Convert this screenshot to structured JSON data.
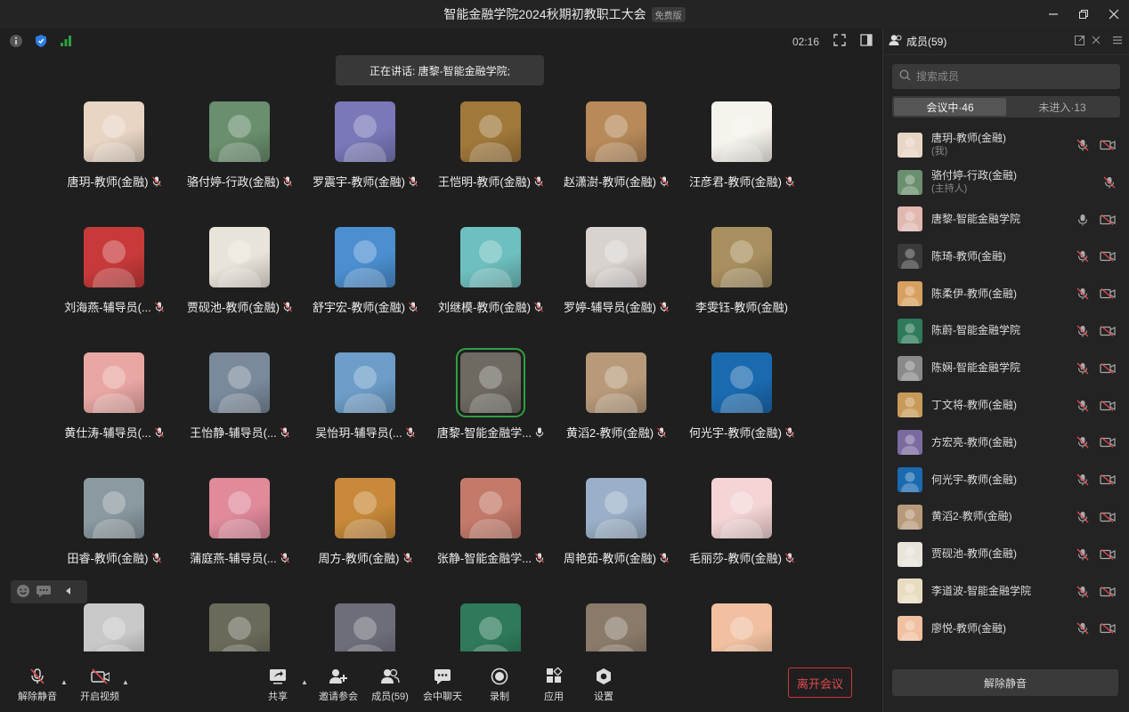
{
  "window": {
    "title": "智能金融学院2024秋期初教职工大会",
    "badge": "免费版"
  },
  "meeting": {
    "timer": "02:16",
    "speaking": "正在讲话: 唐黎-智能金融学院;"
  },
  "colors": {
    "accent_green": "#2ea043",
    "leave_red": "#d0343a",
    "muted_red": "#e04a4f"
  },
  "grid": [
    {
      "name": "唐玥-教师(金融)",
      "mic": "muted",
      "color": "#e8d5c4",
      "icon": "baby-avatar"
    },
    {
      "name": "骆付婷-行政(金融)",
      "mic": "muted",
      "color": "#6a8f6e",
      "icon": "street-avatar"
    },
    {
      "name": "罗震宇-教师(金融)",
      "mic": "muted",
      "color": "#7a78b8",
      "icon": "bear-avatar"
    },
    {
      "name": "王恺明-教师(金融)",
      "mic": "muted",
      "color": "#a0783a",
      "icon": "leopard-avatar"
    },
    {
      "name": "赵潇澍-教师(金融)",
      "mic": "muted",
      "color": "#b88a5a",
      "icon": "cartoon-avatar"
    },
    {
      "name": "汪彦君-教师(金融)",
      "mic": "muted",
      "color": "#f6f2ec",
      "icon": "lion-avatar"
    },
    {
      "name": "刘海燕-辅导员(...",
      "mic": "muted",
      "color": "#c83a3a",
      "icon": "girl-avatar"
    },
    {
      "name": "贾砚池-教师(金融)",
      "mic": "muted",
      "color": "#e9e4d9",
      "icon": "glasses-avatar"
    },
    {
      "name": "舒宇宏-教师(金融)",
      "mic": "muted",
      "color": "#4b8fd0",
      "icon": "plant-avatar"
    },
    {
      "name": "刘继模-教师(金融)",
      "mic": "muted",
      "color": "#6ec0c0",
      "icon": "sprout-avatar"
    },
    {
      "name": "罗婷-辅导员(金融)",
      "mic": "muted",
      "color": "#d9d3cf",
      "icon": "woman-avatar"
    },
    {
      "name": "李雯钰-教师(金融)",
      "mic": "none",
      "color": "#a88f5f",
      "icon": "cat-avatar"
    },
    {
      "name": "黄仕涛-辅导员(...",
      "mic": "muted",
      "color": "#e9a7a3",
      "icon": "blossom-avatar"
    },
    {
      "name": "王怡静-辅导员(...",
      "mic": "muted",
      "color": "#7a8a9b",
      "icon": "musician-avatar"
    },
    {
      "name": "吴怡玥-辅导员(...",
      "mic": "muted",
      "color": "#6d9dc8",
      "icon": "road-avatar"
    },
    {
      "name": "唐黎-智能金融学...",
      "mic": "on",
      "color": "#6e6a62",
      "icon": "einstein-avatar",
      "active": true
    },
    {
      "name": "黄滔2-教师(金融)",
      "mic": "muted",
      "color": "#b89a7a",
      "icon": "man-avatar"
    },
    {
      "name": "何光宇-教师(金融)",
      "mic": "muted",
      "color": "#1a6ab0",
      "icon": "diver-avatar"
    },
    {
      "name": "田睿-教师(金融)",
      "mic": "muted",
      "color": "#8a9aa0",
      "icon": "painting-avatar"
    },
    {
      "name": "蒲庭燕-辅导员(...",
      "mic": "muted",
      "color": "#e08a9a",
      "icon": "roses-avatar"
    },
    {
      "name": "周方-教师(金融)",
      "mic": "muted",
      "color": "#c88a3a",
      "icon": "houses-avatar"
    },
    {
      "name": "张静-智能金融学...",
      "mic": "muted",
      "color": "#c47a6a",
      "icon": "flowers-avatar"
    },
    {
      "name": "周艳茹-教师(金融)",
      "mic": "muted",
      "color": "#9ab0c8",
      "icon": "portrait-avatar"
    },
    {
      "name": "毛丽莎-教师(金融)",
      "mic": "muted",
      "color": "#f4d4d4",
      "icon": "pig-avatar"
    },
    {
      "name": "",
      "mic": "none",
      "color": "#c8c8c8",
      "icon": "sketch-avatar"
    },
    {
      "name": "",
      "mic": "none",
      "color": "#6a6a5a",
      "icon": "train-avatar"
    },
    {
      "name": "",
      "mic": "none",
      "color": "#6e6e7a",
      "icon": "anime-avatar"
    },
    {
      "name": "",
      "mic": "none",
      "color": "#2e7a5a",
      "icon": "jungle-avatar"
    },
    {
      "name": "",
      "mic": "none",
      "color": "#8a7a6a",
      "icon": "bear-cartoon-avatar"
    },
    {
      "name": "",
      "mic": "none",
      "color": "#f0c0a0",
      "icon": "clown-avatar"
    }
  ],
  "toolbar": {
    "unmute": "解除静音",
    "video": "开启视频",
    "share": "共享",
    "invite": "邀请参会",
    "members": "成员(59)",
    "chat": "会中聊天",
    "record": "录制",
    "apps": "应用",
    "settings": "设置",
    "leave": "离开会议"
  },
  "side": {
    "title": "成员(59)",
    "search_placeholder": "搜索成员",
    "tab_in": "会议中·46",
    "tab_out": "未进入·13",
    "unmute_all": "解除静音",
    "members": [
      {
        "name": "唐玥-教师(金融)",
        "sub": "(我)",
        "color": "#e8d5c4",
        "mic": "muted",
        "cam": true
      },
      {
        "name": "骆付婷-行政(金融)",
        "sub": "(主持人)",
        "color": "#6a8f6e",
        "mic": "muted",
        "cam": false
      },
      {
        "name": "唐黎-智能金融学院",
        "sub": "",
        "color": "#e0b8b0",
        "mic": "on",
        "cam": true
      },
      {
        "name": "陈琦-教师(金融)",
        "sub": "",
        "color": "#3a3a3a",
        "mic": "muted",
        "cam": true
      },
      {
        "name": "陈柔伊-教师(金融)",
        "sub": "",
        "color": "#d8a060",
        "mic": "muted",
        "cam": true
      },
      {
        "name": "陈蔚-智能金融学院",
        "sub": "",
        "color": "#2e7a5a",
        "mic": "muted",
        "cam": true
      },
      {
        "name": "陈娴-智能金融学院",
        "sub": "",
        "color": "#8a8a8a",
        "mic": "muted",
        "cam": true
      },
      {
        "name": "丁文将-教师(金融)",
        "sub": "",
        "color": "#c89a5a",
        "mic": "muted",
        "cam": true
      },
      {
        "name": "方宏亮-教师(金融)",
        "sub": "",
        "color": "#7a6aa0",
        "mic": "muted",
        "cam": true
      },
      {
        "name": "何光宇-教师(金融)",
        "sub": "",
        "color": "#1a6ab0",
        "mic": "muted",
        "cam": true
      },
      {
        "name": "黄滔2-教师(金融)",
        "sub": "",
        "color": "#b89a7a",
        "mic": "muted",
        "cam": true
      },
      {
        "name": "贾砚池-教师(金融)",
        "sub": "",
        "color": "#e9e4d9",
        "mic": "muted",
        "cam": true
      },
      {
        "name": "李道波-智能金融学院",
        "sub": "",
        "color": "#e8dcc0",
        "mic": "muted",
        "cam": true
      },
      {
        "name": "廖悦-教师(金融)",
        "sub": "",
        "color": "#f0c0a0",
        "mic": "muted",
        "cam": true
      }
    ]
  }
}
